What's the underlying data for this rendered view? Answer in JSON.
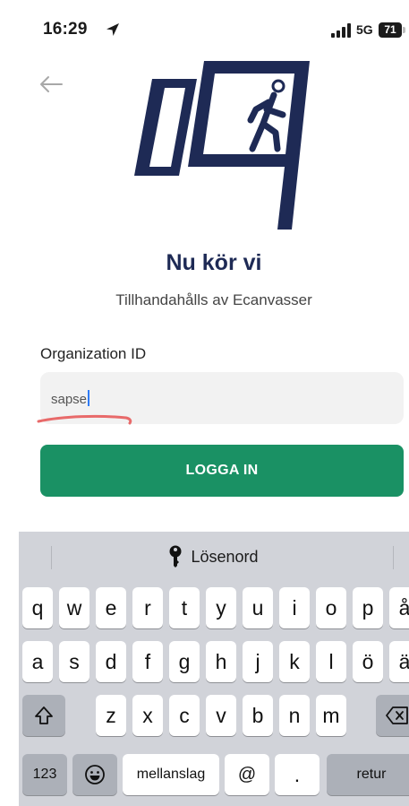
{
  "status": {
    "time": "16:29",
    "network": "5G",
    "battery": "71"
  },
  "header": {
    "title": "Nu kör vi",
    "subtitle": "Tillhandahålls av Ecanvasser"
  },
  "form": {
    "org_label": "Organization ID",
    "org_value": "sapse",
    "login_label": "LOGGA IN"
  },
  "keyboard": {
    "suggestion": "Lösenord",
    "row1": [
      "q",
      "w",
      "e",
      "r",
      "t",
      "y",
      "u",
      "i",
      "o",
      "p",
      "å"
    ],
    "row2": [
      "a",
      "s",
      "d",
      "f",
      "g",
      "h",
      "j",
      "k",
      "l",
      "ö",
      "ä"
    ],
    "row3": [
      "z",
      "x",
      "c",
      "v",
      "b",
      "n",
      "m"
    ],
    "numbers_label": "123",
    "space_label": "mellanslag",
    "at_label": "@",
    "dot_label": ".",
    "return_label": "retur"
  },
  "colors": {
    "brand_navy": "#1e2a55",
    "primary_green": "#1a9164"
  },
  "icons": [
    "location-arrow-icon",
    "signal-icon",
    "battery-icon",
    "back-arrow-icon",
    "key-icon",
    "shift-icon",
    "backspace-icon",
    "emoji-icon"
  ]
}
